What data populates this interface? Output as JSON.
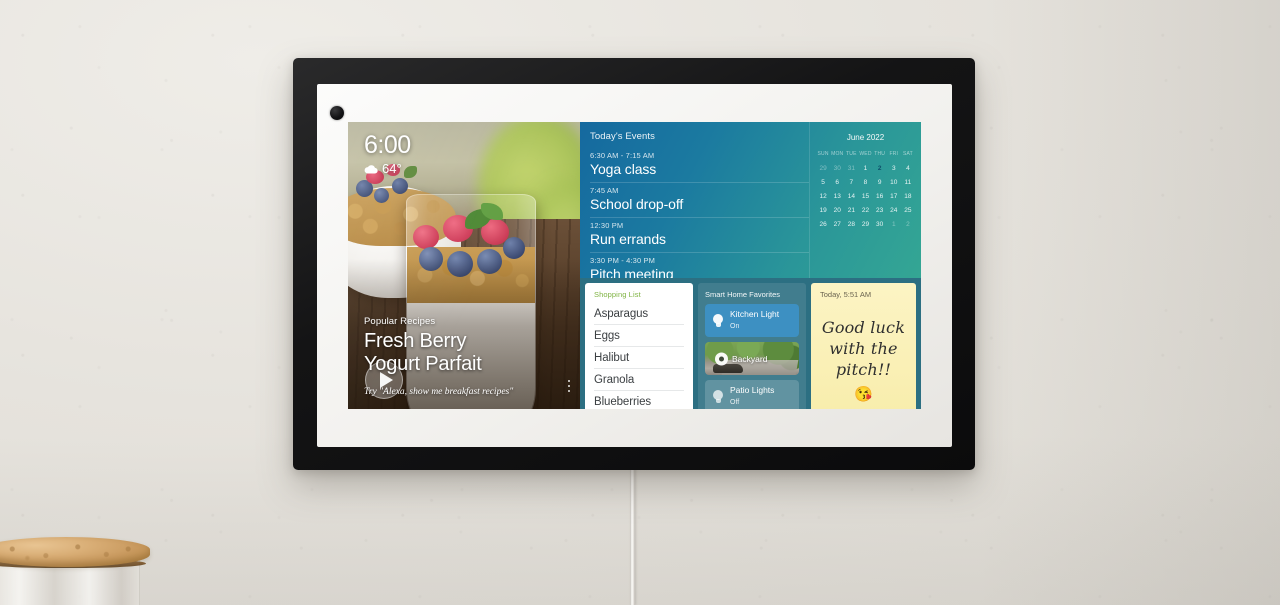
{
  "device": {
    "name": "Echo Show smart display",
    "camera_icon": "camera-dot"
  },
  "recipe_card": {
    "clock": "6:00",
    "weather_icon": "cloud-icon",
    "temperature": "64°",
    "play_icon": "play-icon",
    "kicker": "Popular Recipes",
    "title_line1": "Fresh Berry",
    "title_line2": "Yogurt Parfait",
    "hint": "Try \"Alexa, show me breakfast recipes\"",
    "overflow_icon": "kebab-menu-icon"
  },
  "events": {
    "title": "Today's Events",
    "items": [
      {
        "time": "6:30 AM - 7:15 AM",
        "name": "Yoga class"
      },
      {
        "time": "7:45 AM",
        "name": "School drop-off"
      },
      {
        "time": "12:30 PM",
        "name": "Run errands"
      },
      {
        "time": "3:30 PM - 4:30 PM",
        "name": "Pitch meeting"
      }
    ]
  },
  "calendar": {
    "title": "June 2022",
    "dow": [
      "SUN",
      "MON",
      "TUE",
      "WED",
      "THU",
      "FRI",
      "SAT"
    ],
    "weeks": [
      [
        {
          "d": "29",
          "dim": true
        },
        {
          "d": "30",
          "dim": true
        },
        {
          "d": "31",
          "dim": true
        },
        {
          "d": "1"
        },
        {
          "d": "2",
          "today": true
        },
        {
          "d": "3"
        },
        {
          "d": "4"
        }
      ],
      [
        {
          "d": "5"
        },
        {
          "d": "6"
        },
        {
          "d": "7"
        },
        {
          "d": "8"
        },
        {
          "d": "9"
        },
        {
          "d": "10"
        },
        {
          "d": "11"
        }
      ],
      [
        {
          "d": "12"
        },
        {
          "d": "13"
        },
        {
          "d": "14"
        },
        {
          "d": "15"
        },
        {
          "d": "16"
        },
        {
          "d": "17"
        },
        {
          "d": "18"
        }
      ],
      [
        {
          "d": "19"
        },
        {
          "d": "20"
        },
        {
          "d": "21"
        },
        {
          "d": "22"
        },
        {
          "d": "23"
        },
        {
          "d": "24"
        },
        {
          "d": "25"
        }
      ],
      [
        {
          "d": "26"
        },
        {
          "d": "27"
        },
        {
          "d": "28"
        },
        {
          "d": "29"
        },
        {
          "d": "30"
        },
        {
          "d": "1",
          "dim": true
        },
        {
          "d": "2",
          "dim": true
        }
      ]
    ],
    "today_highlight_color": "#5fd2ef"
  },
  "shopping_list": {
    "title": "Shopping List",
    "title_color": "#7fb342",
    "items": [
      "Asparagus",
      "Eggs",
      "Halibut",
      "Granola",
      "Blueberries"
    ]
  },
  "smart_home": {
    "title": "Smart Home Favorites",
    "tiles": [
      {
        "name": "Kitchen Light",
        "state": "On",
        "icon": "lightbulb-icon",
        "type": "light",
        "on": true
      },
      {
        "name": "Backyard",
        "state": "",
        "icon": "camera-icon",
        "type": "camera",
        "on": false
      },
      {
        "name": "Patio Lights",
        "state": "Off",
        "icon": "lightbulb-icon",
        "type": "light",
        "on": false
      }
    ],
    "on_color": "#3d90c2"
  },
  "sticky_note": {
    "timestamp": "Today, 5:51 AM",
    "message_line1": "Good luck",
    "message_line2": "with the",
    "message_line3": "pitch!!",
    "emoji": "😘",
    "paper_color": "#faf0b6"
  },
  "room": {
    "wall_color": "#e8e6e1",
    "cable": "power-cable",
    "jar": "cork-lid-glass-jar"
  }
}
